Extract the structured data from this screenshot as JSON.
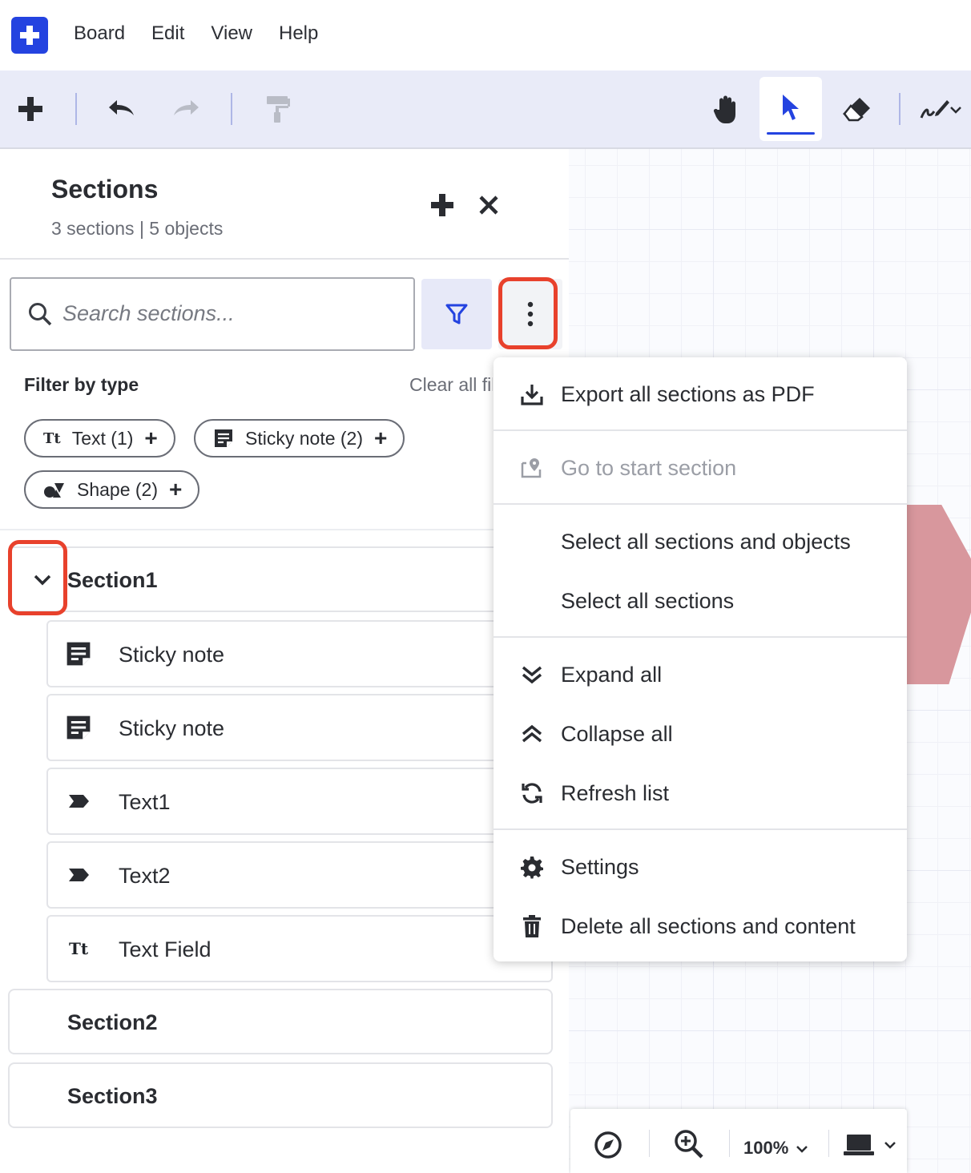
{
  "menubar": {
    "items": [
      "Board",
      "Edit",
      "View",
      "Help"
    ]
  },
  "toolbar": {
    "tools": [
      "add-icon",
      "undo-icon",
      "redo-icon",
      "format-paint-icon",
      "hand-icon",
      "select-pointer-icon",
      "eraser-icon",
      "pen-icon"
    ],
    "active_tool": "select-pointer-icon",
    "accent": "#2443e0"
  },
  "panel": {
    "title": "Sections",
    "subtitle": "3 sections | 5 objects",
    "search_placeholder": "Search sections...",
    "filter_label": "Filter by type",
    "clear_all": "Clear all filters",
    "chips": [
      {
        "label": "Text (1)",
        "icon": "text-type-icon"
      },
      {
        "label": "Sticky note (2)",
        "icon": "sticky-note-icon"
      },
      {
        "label": "Shape (2)",
        "icon": "shapes-icon"
      }
    ],
    "sections": [
      {
        "name": "Section1",
        "expanded": true,
        "items": [
          {
            "label": "Sticky note",
            "icon": "sticky-note-icon"
          },
          {
            "label": "Sticky note",
            "icon": "sticky-note-icon"
          },
          {
            "label": "Text1",
            "icon": "label-tag-icon"
          },
          {
            "label": "Text2",
            "icon": "label-tag-icon"
          },
          {
            "label": "Text Field",
            "icon": "text-type-icon"
          }
        ]
      },
      {
        "name": "Section2",
        "expanded": false
      },
      {
        "name": "Section3",
        "expanded": false
      }
    ]
  },
  "menu": {
    "items": [
      {
        "label": "Export all sections as PDF",
        "icon": "download-icon",
        "disabled": false
      },
      {
        "label": "Go to start section",
        "icon": "map-pin-icon",
        "disabled": true
      },
      {
        "label": "Select all sections and objects",
        "icon": "",
        "disabled": false
      },
      {
        "label": "Select all sections",
        "icon": "",
        "disabled": false
      },
      {
        "label": "Expand all",
        "icon": "double-chevron-down-icon",
        "disabled": false
      },
      {
        "label": "Collapse all",
        "icon": "double-chevron-up-icon",
        "disabled": false
      },
      {
        "label": "Refresh list",
        "icon": "refresh-icon",
        "disabled": false
      },
      {
        "label": "Settings",
        "icon": "gear-icon",
        "disabled": false
      },
      {
        "label": "Delete all sections and content",
        "icon": "trash-icon",
        "disabled": false
      }
    ]
  },
  "zoombar": {
    "zoom": "100%"
  },
  "colors": {
    "highlight": "#e8412c",
    "canvas_shape": "#d8979d"
  }
}
